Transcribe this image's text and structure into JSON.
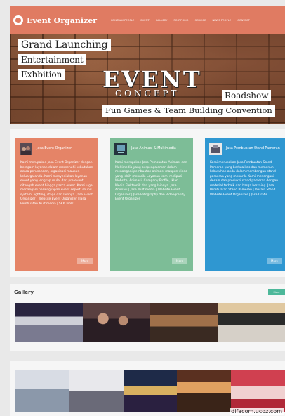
{
  "header": {
    "brand": "Event Organizer",
    "menu": [
      "KONTRAK PEOPLE",
      "EVENT",
      "GALLERY",
      "PORTFOLIO",
      "SERVICE",
      "NEWS PEOPLE",
      "CONTACT"
    ],
    "colors": {
      "header_bg": "#e07b62"
    }
  },
  "hero": {
    "grand": "Grand Launching",
    "entertainment": "Entertainment",
    "exhibition": "Exhbition",
    "event": "EVENT",
    "concept": "CONCEPT",
    "roadshow": "Roadshow",
    "fun": "Fun Games & Team Building Convention"
  },
  "cards": [
    {
      "title": "Jasa Event Organizer",
      "body": "Kami merupakan Jasa Event Organizer dengan beragam layanan dalam memenuhi kebutuhan acara perusahaan, organisasi maupun keluarga anda. Kami menyediakan layanan event yang lengkap mulai dari pra event, ditengah event hingga pasca event. Kami juga menangani perlengkapan event seperti sound system, lighting, stage dan lainnya. Jasa Event Organizer | Website Event Organizer | Jasa Pembuatan Multimedia | SFX Tools",
      "more": "More",
      "color": "#e58467"
    },
    {
      "title": "Jasa Animasi & Multimedia",
      "body": "Kami merupakan Jasa Pembuatan Animasi dan Multimedia yang berpengalaman dalam menangani pembuatan animasi maupun video yang lebih menarik. Layanan kami meliputi Website, Animasi, Company Profile, Iklan Media Elektronik dan yang lainnya. Jasa Animasi | Jasa Multimedia | Website Event Organizer | Jasa Fotography dan Videography Event Organizer.",
      "more": "More",
      "color": "#7dbd97"
    },
    {
      "title": "Jasa Pembuatan Stand Pameran",
      "body": "Kami merupakan Jasa Pembuatan Stand Pameran yang berkualitas dan memenuhi kebutuhan anda dalam membangun stand pameran yang menarik. Kami menangani desain dan produksi stand pameran dengan material terbaik dan harga bersaing. Jasa Pembuatan Stand Pameran | Desain Stand | Website Event Organizer | Jasa Grafis",
      "more": "More",
      "color": "#2f97d1"
    }
  ],
  "gallery": {
    "title": "Gallery",
    "more": "More"
  },
  "watermark": "difacom.ucoz.com"
}
